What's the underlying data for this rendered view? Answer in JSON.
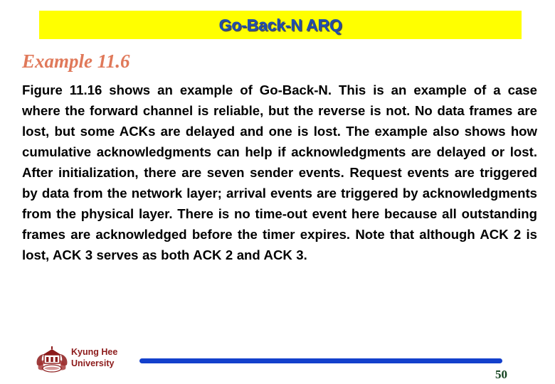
{
  "slide": {
    "title": "Go-Back-N ARQ",
    "title_bar_color": "#FFFF00",
    "title_text_color": "#1F4EB0",
    "background_color": "#FFFFFF"
  },
  "example": {
    "heading": "Example 11.6",
    "heading_color": "#E0795A",
    "body": "Figure 11.16 shows an example of Go-Back-N. This is an example of a case where the forward channel is reliable, but the reverse is not. No data frames are lost, but some ACKs are delayed and one is lost. The example also shows how cumulative acknowledgments can help if acknowledgments are delayed or lost. After initialization, there are seven sender events. Request events are triggered by data from the network layer; arrival events are triggered by acknowledgments from the physical layer. There is no time-out event here because all outstanding frames are acknowledged before the timer expires. Note that although ACK 2 is lost, ACK 3 serves as both ACK 2 and ACK 3."
  },
  "footer": {
    "logo_icon": "kyung-hee-university-crest-icon",
    "institution_line_1": "Kyung Hee",
    "institution_line_2": "University",
    "institution_color": "#8C1A1A",
    "rule_color": "#1340CC",
    "page_number": "50",
    "page_number_color": "#13431F"
  }
}
